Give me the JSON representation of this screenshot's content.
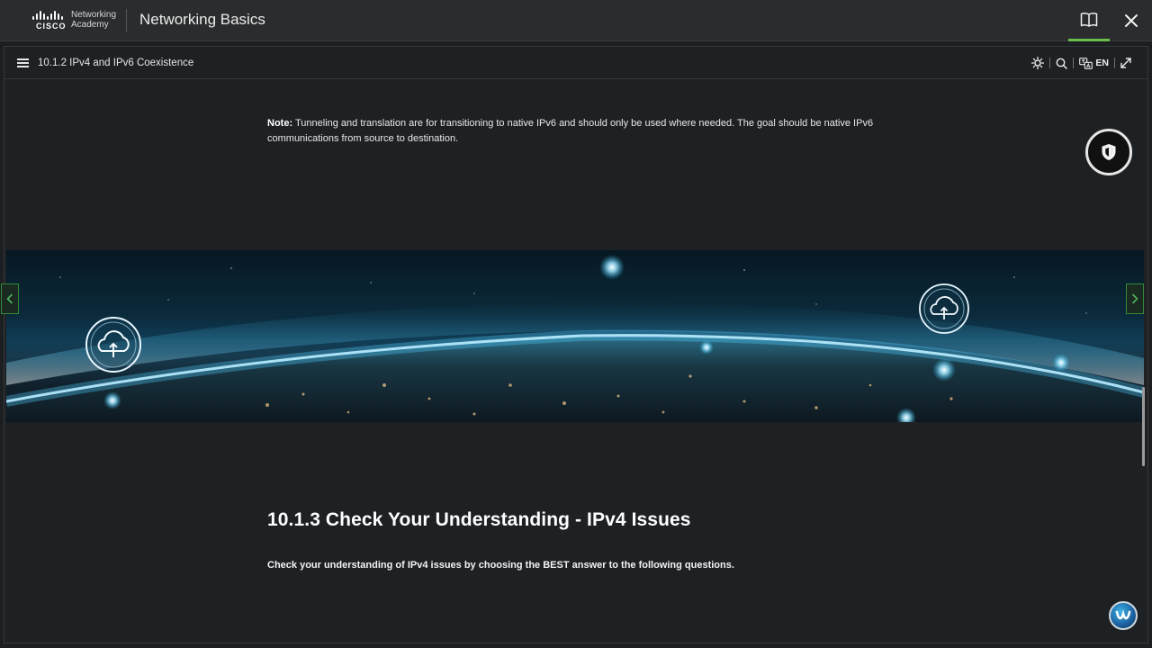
{
  "header": {
    "brand_line1": "Networking",
    "brand_line2": "Academy",
    "brand_mark": "CISCO",
    "app_title": "Networking Basics",
    "book_icon": "book-open-icon",
    "close_icon": "close-icon",
    "active_accent": "#6abf4b"
  },
  "subbar": {
    "breadcrumb": "10.1.2 IPv4 and IPv6 Coexistence",
    "menu_icon": "hamburger-icon",
    "tools": {
      "theme_icon": "sun-icon",
      "search_icon": "search-icon",
      "language_icon": "translate-icon",
      "language_label": "EN",
      "fullscreen_icon": "expand-icon"
    }
  },
  "content": {
    "note_label": "Note:",
    "note_text": " Tunneling and translation are for transitioning to native IPv6 and should only be used where needed. The goal should be native IPv6 communications from source to destination.",
    "section_heading": "10.1.3 Check Your Understanding - IPv4 Issues",
    "section_intro": "Check your understanding of IPv4 issues by choosing the BEST answer to the following questions."
  },
  "banner": {
    "description_icon_left": "cloud-upload-icon",
    "description_icon_right": "cloud-upload-icon"
  },
  "floating": {
    "shield_icon": "shield-icon",
    "assistant_icon": "webex-icon"
  },
  "nav": {
    "prev_icon": "chevron-left-icon",
    "next_icon": "chevron-right-icon",
    "accent": "#2f8a3a"
  }
}
